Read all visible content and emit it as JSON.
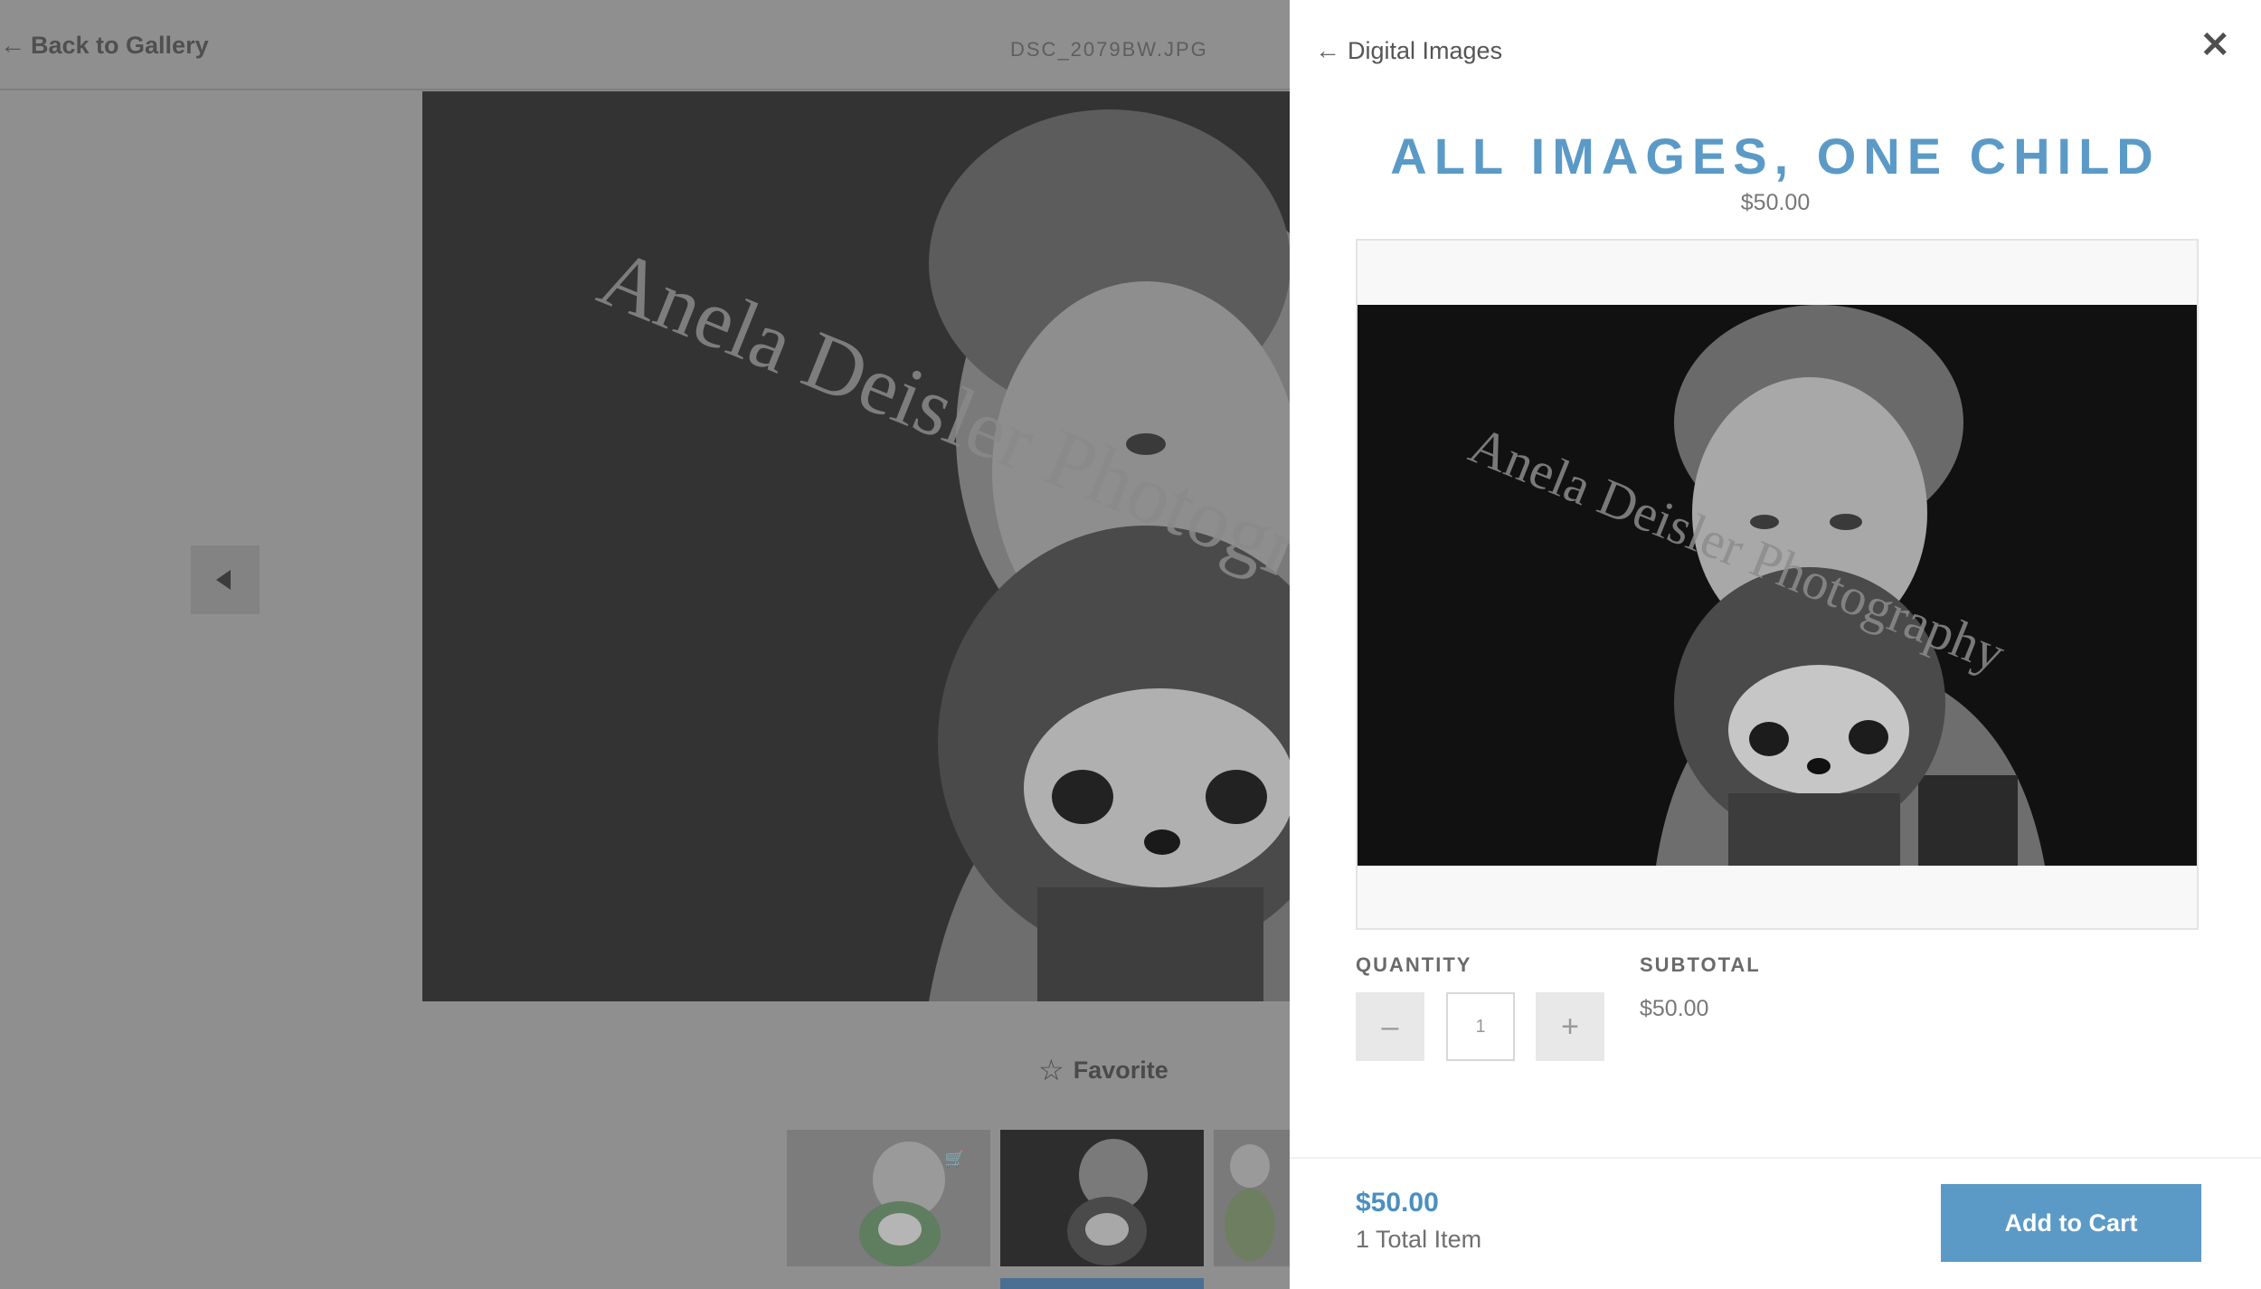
{
  "gallery": {
    "back_label": "Back to Gallery",
    "filename": "DSC_2079BW.JPG",
    "favorite_label": "Favorite",
    "watermark": "Anela Deisler Photography"
  },
  "panel": {
    "back_label": "Digital Images",
    "title": "ALL IMAGES, ONE CHILD",
    "price": "$50.00",
    "quantity_label": "QUANTITY",
    "quantity_value": "1",
    "subtotal_label": "SUBTOTAL",
    "subtotal_value": "$50.00",
    "footer_total": "$50.00",
    "footer_items": "1 Total Item",
    "add_to_cart_label": "Add to Cart"
  },
  "colors": {
    "accent": "#5b9ac6",
    "overlay_gray": "#8f8f8f"
  },
  "icons": {
    "back": "arrow-left-icon",
    "close": "close-icon",
    "prev": "triangle-left-icon",
    "favorite": "star-outline-icon",
    "cart": "cart-icon"
  }
}
